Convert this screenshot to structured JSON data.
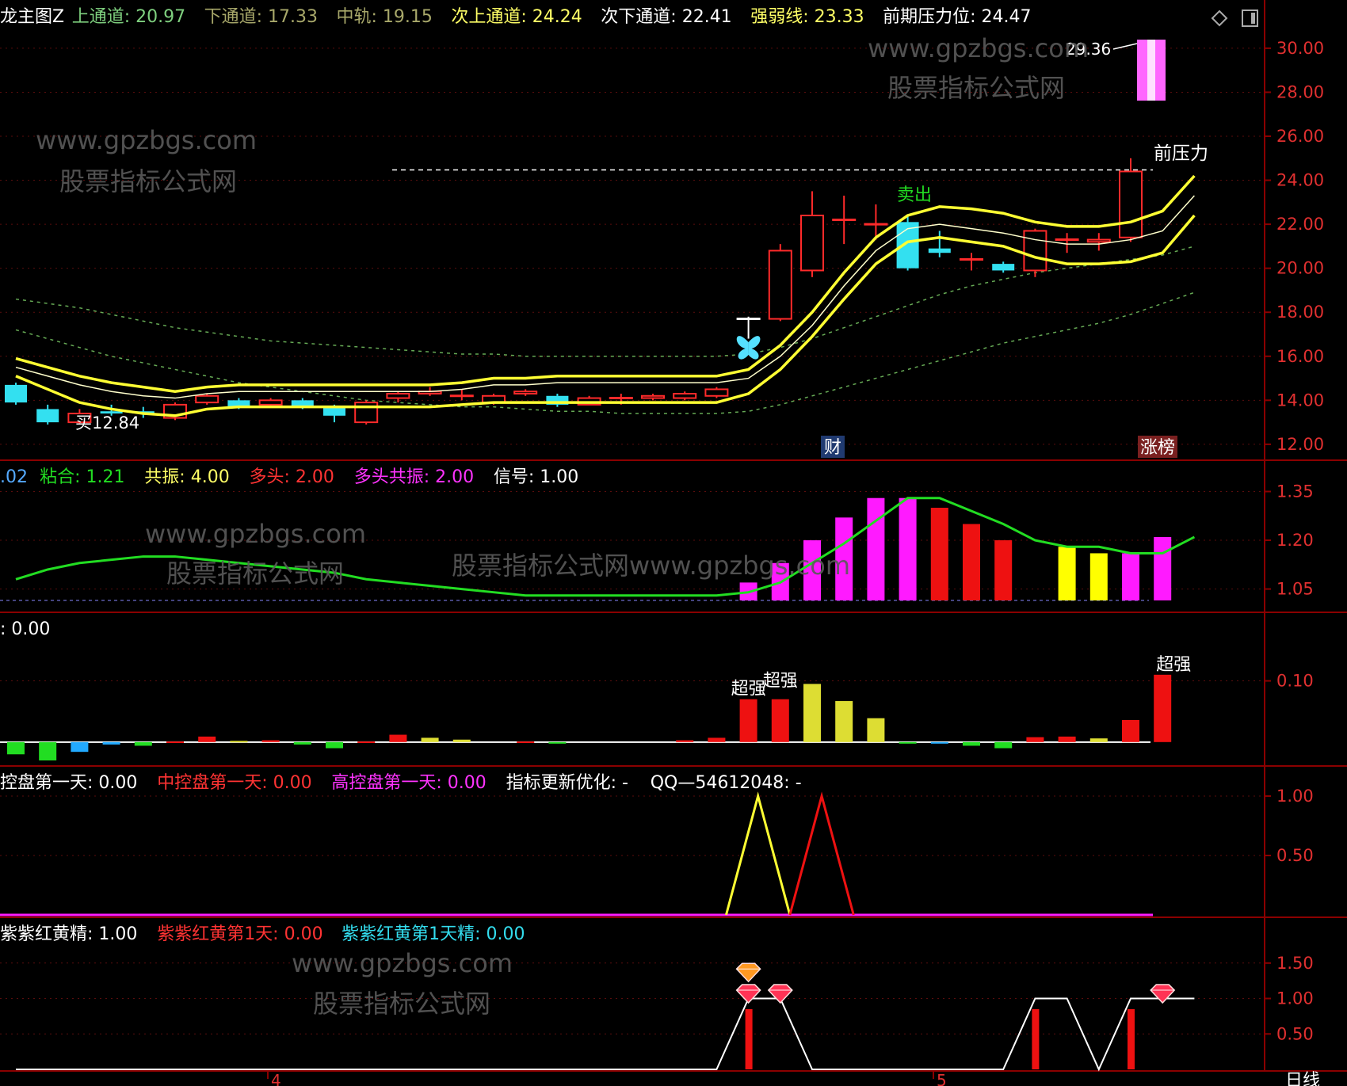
{
  "colors": {
    "background": "#000000",
    "panel_border": "#8b0000",
    "axis_text": "#e03030",
    "channel": "#ffff33",
    "up": "#ff2a2a",
    "down": "#33e0f0",
    "magenta": "#ff1aff",
    "yellow": "#ffff00",
    "green": "#22dd22",
    "white": "#ffffff"
  },
  "toolbar": {
    "diamond_icon": "diamond-icon",
    "window_icon": "window-icon"
  },
  "watermarks": {
    "url": "www.gpzbgs.com",
    "cn": "股票指标公式网",
    "combined": "股票指标公式网www.gpzbgs.com"
  },
  "timeline": {
    "labels": [
      "4",
      "5"
    ],
    "period": "日线"
  },
  "chart_data": [
    {
      "type": "candlestick",
      "panel": "main",
      "header": [
        {
          "text": "龙主图Z",
          "color": "#ffffff"
        },
        {
          "text": "上通道: 20.97",
          "color": "#7fd07f"
        },
        {
          "text": "下通道: 17.33",
          "color": "#a8a86a"
        },
        {
          "text": "中轨: 19.15",
          "color": "#a8a86a"
        },
        {
          "text": "次上通道: 24.24",
          "color": "#ffff66"
        },
        {
          "text": "次下通道: 22.41",
          "color": "#ffffff"
        },
        {
          "text": "强弱线: 23.33",
          "color": "#ffff66"
        },
        {
          "text": "前期压力位: 24.47",
          "color": "#ffffff"
        }
      ],
      "ylim": [
        11.6,
        31.4
      ],
      "yticks": [
        "12.00",
        "14.00",
        "16.00",
        "18.00",
        "20.00",
        "22.00",
        "24.00",
        "26.00",
        "28.00",
        "30.00"
      ],
      "grid": true,
      "candles": [
        {
          "o": 14.7,
          "c": 13.9,
          "h": 14.8,
          "l": 13.8
        },
        {
          "o": 13.6,
          "c": 13.0,
          "h": 13.8,
          "l": 12.9
        },
        {
          "o": 13.0,
          "c": 13.4,
          "h": 13.6,
          "l": 12.9
        },
        {
          "o": 13.5,
          "c": 13.4,
          "h": 13.8,
          "l": 13.3
        },
        {
          "o": 13.5,
          "c": 13.4,
          "h": 13.7,
          "l": 13.2
        },
        {
          "o": 13.2,
          "c": 13.8,
          "h": 13.9,
          "l": 13.1
        },
        {
          "o": 13.9,
          "c": 14.2,
          "h": 14.3,
          "l": 13.8
        },
        {
          "o": 14.0,
          "c": 13.7,
          "h": 14.1,
          "l": 13.6
        },
        {
          "o": 13.8,
          "c": 14.0,
          "h": 14.1,
          "l": 13.7
        },
        {
          "o": 14.0,
          "c": 13.7,
          "h": 14.1,
          "l": 13.6
        },
        {
          "o": 13.7,
          "c": 13.3,
          "h": 13.8,
          "l": 13.0
        },
        {
          "o": 13.0,
          "c": 13.9,
          "h": 14.0,
          "l": 12.9
        },
        {
          "o": 14.1,
          "c": 14.3,
          "h": 14.4,
          "l": 13.9
        },
        {
          "o": 14.3,
          "c": 14.4,
          "h": 14.6,
          "l": 14.2
        },
        {
          "o": 14.2,
          "c": 14.2,
          "h": 14.5,
          "l": 14.0
        },
        {
          "o": 13.9,
          "c": 14.2,
          "h": 14.3,
          "l": 13.8
        },
        {
          "o": 14.3,
          "c": 14.4,
          "h": 14.5,
          "l": 14.2
        },
        {
          "o": 14.2,
          "c": 13.8,
          "h": 14.3,
          "l": 13.7
        },
        {
          "o": 13.8,
          "c": 14.1,
          "h": 14.2,
          "l": 13.8
        },
        {
          "o": 14.1,
          "c": 14.1,
          "h": 14.3,
          "l": 13.8
        },
        {
          "o": 14.1,
          "c": 14.2,
          "h": 14.3,
          "l": 14.0
        },
        {
          "o": 14.1,
          "c": 14.3,
          "h": 14.4,
          "l": 14.0
        },
        {
          "o": 14.2,
          "c": 14.5,
          "h": 14.6,
          "l": 14.1
        },
        {
          "o": 17.7,
          "c": 17.7,
          "h": 17.8,
          "l": 16.8
        },
        {
          "o": 17.7,
          "c": 20.8,
          "h": 21.1,
          "l": 17.6
        },
        {
          "o": 19.9,
          "c": 22.4,
          "h": 23.5,
          "l": 19.6
        },
        {
          "o": 22.2,
          "c": 22.2,
          "h": 23.3,
          "l": 21.1
        },
        {
          "o": 22.0,
          "c": 22.0,
          "h": 22.9,
          "l": 21.3
        },
        {
          "o": 22.1,
          "c": 20.0,
          "h": 22.4,
          "l": 19.9
        },
        {
          "o": 20.9,
          "c": 20.7,
          "h": 21.7,
          "l": 20.5
        },
        {
          "o": 20.4,
          "c": 20.4,
          "h": 20.7,
          "l": 19.9
        },
        {
          "o": 20.2,
          "c": 19.9,
          "h": 20.3,
          "l": 19.8
        },
        {
          "o": 19.9,
          "c": 21.7,
          "h": 21.8,
          "l": 19.6
        },
        {
          "o": 21.3,
          "c": 21.3,
          "h": 21.6,
          "l": 20.7
        },
        {
          "o": 21.2,
          "c": 21.3,
          "h": 21.6,
          "l": 20.8
        },
        {
          "o": 21.4,
          "c": 24.4,
          "h": 25.0,
          "l": 21.2
        }
      ],
      "lines": [
        {
          "name": "上通道",
          "values": [
            15.9,
            15.5,
            15.1,
            14.8,
            14.6,
            14.4,
            14.6,
            14.7,
            14.7,
            14.7,
            14.7,
            14.7,
            14.7,
            14.7,
            14.8,
            15.0,
            15.0,
            15.1,
            15.1,
            15.1,
            15.1,
            15.1,
            15.1,
            15.4,
            16.5,
            18.0,
            19.8,
            21.4,
            22.4,
            22.8,
            22.7,
            22.5,
            22.1,
            21.9,
            21.9,
            22.1,
            22.6,
            24.2
          ]
        },
        {
          "name": "中轨",
          "values": [
            15.5,
            15.1,
            14.7,
            14.4,
            14.2,
            14.1,
            14.3,
            14.4,
            14.4,
            14.4,
            14.4,
            14.4,
            14.4,
            14.4,
            14.5,
            14.7,
            14.7,
            14.8,
            14.8,
            14.8,
            14.8,
            14.8,
            14.8,
            15.0,
            16.0,
            17.4,
            19.2,
            20.8,
            21.8,
            22.0,
            21.8,
            21.6,
            21.3,
            21.1,
            21.1,
            21.3,
            21.7,
            23.3
          ]
        },
        {
          "name": "下通道",
          "values": [
            15.1,
            14.5,
            13.9,
            13.6,
            13.4,
            13.3,
            13.6,
            13.7,
            13.7,
            13.7,
            13.7,
            13.7,
            13.7,
            13.7,
            13.8,
            13.9,
            13.9,
            13.9,
            13.9,
            13.9,
            13.9,
            13.9,
            13.9,
            14.3,
            15.4,
            16.9,
            18.6,
            20.2,
            21.2,
            21.4,
            21.2,
            21.0,
            20.5,
            20.2,
            20.2,
            20.3,
            20.7,
            22.4
          ]
        },
        {
          "name": "上虚线",
          "values": [
            18.6,
            18.4,
            18.2,
            17.9,
            17.6,
            17.3,
            17.1,
            16.9,
            16.7,
            16.6,
            16.5,
            16.4,
            16.3,
            16.2,
            16.1,
            16.1,
            16.0,
            16.0,
            16.0,
            16.0,
            16.0,
            16.0,
            16.0,
            16.1,
            16.4,
            16.8,
            17.3,
            17.8,
            18.3,
            18.8,
            19.2,
            19.5,
            19.8,
            20.0,
            20.2,
            20.4,
            20.6,
            21.0
          ]
        },
        {
          "name": "下虚线",
          "values": [
            17.2,
            16.8,
            16.4,
            16.0,
            15.7,
            15.4,
            15.1,
            14.8,
            14.6,
            14.4,
            14.2,
            14.0,
            13.9,
            13.8,
            13.7,
            13.7,
            13.6,
            13.5,
            13.5,
            13.4,
            13.4,
            13.4,
            13.4,
            13.5,
            13.8,
            14.2,
            14.6,
            15.0,
            15.4,
            15.8,
            16.2,
            16.6,
            16.9,
            17.2,
            17.5,
            17.9,
            18.4,
            18.9
          ]
        }
      ],
      "pressure_level": 24.47,
      "labels": {
        "buy": "买12.84",
        "sell": "卖出",
        "pressure": "前压力",
        "cai": "财",
        "zhangbang": "涨榜",
        "peak": "29.36"
      }
    },
    {
      "type": "bar",
      "panel": "sub1",
      "header": [
        {
          "text": ".02",
          "color": "#55aaff"
        },
        {
          "text": "粘合: 1.21",
          "color": "#22dd22"
        },
        {
          "text": "共振: 4.00",
          "color": "#ffff66"
        },
        {
          "text": "多头: 2.00",
          "color": "#ff3333"
        },
        {
          "text": "多头共振: 2.00",
          "color": "#ff33ff"
        },
        {
          "text": "信号: 1.00",
          "color": "#ffffff"
        }
      ],
      "ylim": [
        1.01,
        1.4
      ],
      "yticks": [
        "1.35",
        "1.20",
        "1.05"
      ],
      "line_values": [
        1.08,
        1.11,
        1.13,
        1.14,
        1.15,
        1.15,
        1.14,
        1.13,
        1.12,
        1.11,
        1.1,
        1.08,
        1.07,
        1.06,
        1.05,
        1.04,
        1.03,
        1.03,
        1.03,
        1.03,
        1.03,
        1.03,
        1.03,
        1.04,
        1.07,
        1.13,
        1.19,
        1.26,
        1.33,
        1.33,
        1.29,
        1.25,
        1.2,
        1.18,
        1.18,
        1.16,
        1.16,
        1.21
      ],
      "bars": [
        {
          "i": 23,
          "v": 1.07,
          "color": "#ff1aff"
        },
        {
          "i": 24,
          "v": 1.13,
          "color": "#ff1aff"
        },
        {
          "i": 25,
          "v": 1.2,
          "color": "#ff1aff"
        },
        {
          "i": 26,
          "v": 1.27,
          "color": "#ff1aff"
        },
        {
          "i": 27,
          "v": 1.33,
          "color": "#ff1aff"
        },
        {
          "i": 28,
          "v": 1.33,
          "color": "#ff1aff"
        },
        {
          "i": 29,
          "v": 1.3,
          "color": "#ee1111"
        },
        {
          "i": 30,
          "v": 1.25,
          "color": "#ee1111"
        },
        {
          "i": 31,
          "v": 1.2,
          "color": "#ee1111"
        },
        {
          "i": 33,
          "v": 1.18,
          "color": "#ffff00"
        },
        {
          "i": 34,
          "v": 1.16,
          "color": "#ffff00"
        },
        {
          "i": 35,
          "v": 1.16,
          "color": "#ff1aff"
        },
        {
          "i": 36,
          "v": 1.21,
          "color": "#ff1aff"
        }
      ]
    },
    {
      "type": "bar",
      "panel": "sub2",
      "header": [
        {
          "text": ": 0.00",
          "color": "#ffffff"
        }
      ],
      "ylim": [
        -0.03,
        0.19
      ],
      "yticks": [
        "0.10"
      ],
      "bars": [
        {
          "i": 0,
          "v": -0.02,
          "color": "#22dd22"
        },
        {
          "i": 1,
          "v": -0.03,
          "color": "#22dd22"
        },
        {
          "i": 2,
          "v": -0.016,
          "color": "#22aaff"
        },
        {
          "i": 3,
          "v": -0.004,
          "color": "#22aaff"
        },
        {
          "i": 4,
          "v": -0.006,
          "color": "#22dd22"
        },
        {
          "i": 5,
          "v": 0.001,
          "color": "#ee1111"
        },
        {
          "i": 6,
          "v": 0.009,
          "color": "#ee1111"
        },
        {
          "i": 7,
          "v": 0.002,
          "color": "#dddd33"
        },
        {
          "i": 8,
          "v": 0.003,
          "color": "#ee1111"
        },
        {
          "i": 9,
          "v": -0.004,
          "color": "#22dd22"
        },
        {
          "i": 10,
          "v": -0.01,
          "color": "#22dd22"
        },
        {
          "i": 11,
          "v": 0.001,
          "color": "#ee1111"
        },
        {
          "i": 12,
          "v": 0.012,
          "color": "#ee1111"
        },
        {
          "i": 13,
          "v": 0.007,
          "color": "#dddd33"
        },
        {
          "i": 14,
          "v": 0.004,
          "color": "#dddd33"
        },
        {
          "i": 16,
          "v": 0.001,
          "color": "#ee1111"
        },
        {
          "i": 17,
          "v": -0.002,
          "color": "#22dd22"
        },
        {
          "i": 21,
          "v": 0.003,
          "color": "#ee1111"
        },
        {
          "i": 22,
          "v": 0.007,
          "color": "#ee1111"
        },
        {
          "i": 23,
          "v": 0.07,
          "color": "#ee1111"
        },
        {
          "i": 24,
          "v": 0.07,
          "color": "#ee1111"
        },
        {
          "i": 25,
          "v": 0.095,
          "color": "#dddd33"
        },
        {
          "i": 26,
          "v": 0.067,
          "color": "#dddd33"
        },
        {
          "i": 27,
          "v": 0.039,
          "color": "#dddd33"
        },
        {
          "i": 28,
          "v": -0.002,
          "color": "#22dd22"
        },
        {
          "i": 29,
          "v": -0.002,
          "color": "#22aaff"
        },
        {
          "i": 30,
          "v": -0.006,
          "color": "#22dd22"
        },
        {
          "i": 31,
          "v": -0.01,
          "color": "#22dd22"
        },
        {
          "i": 32,
          "v": 0.008,
          "color": "#ee1111"
        },
        {
          "i": 33,
          "v": 0.009,
          "color": "#ee1111"
        },
        {
          "i": 34,
          "v": 0.006,
          "color": "#dddd33"
        },
        {
          "i": 35,
          "v": 0.036,
          "color": "#ee1111"
        },
        {
          "i": 36,
          "v": 0.11,
          "color": "#ee1111"
        }
      ],
      "labels": [
        {
          "i": 23,
          "text": "超强"
        },
        {
          "i": 24,
          "text": "超强"
        },
        {
          "i": 36,
          "text": "超强"
        }
      ]
    },
    {
      "type": "line",
      "panel": "sub3",
      "header": [
        {
          "text": "控盘第一天: 0.00",
          "color": "#ffffff"
        },
        {
          "text": "中控盘第一天: 0.00",
          "color": "#ff3333"
        },
        {
          "text": "高控盘第一天: 0.00",
          "color": "#ff33ff"
        },
        {
          "text": "指标更新优化: -",
          "color": "#ffffff"
        },
        {
          "text": "QQ—54612048: -",
          "color": "#ffffff"
        }
      ],
      "ylim": [
        0,
        1.1
      ],
      "yticks": [
        "1.00",
        "0.50"
      ],
      "series": [
        {
          "color": "#ffff33",
          "x": [
            22.3,
            23.3,
            24.3
          ],
          "y": [
            0,
            1,
            0
          ]
        },
        {
          "color": "#ee1111",
          "x": [
            24.3,
            25.3,
            26.3
          ],
          "y": [
            0,
            1,
            0
          ]
        }
      ],
      "baseline_color": "#ff1aff"
    },
    {
      "type": "line",
      "panel": "sub4",
      "header": [
        {
          "text": "紫紫红黄精: 1.00",
          "color": "#ffffff"
        },
        {
          "text": "紫紫红黄第1天: 0.00",
          "color": "#ff3333"
        },
        {
          "text": "紫紫红黄第1天精: 0.00",
          "color": "#33ddee"
        }
      ],
      "ylim": [
        0,
        1.9
      ],
      "yticks": [
        "1.50",
        "1.00",
        "0.50"
      ],
      "line_values": [
        0,
        0,
        0,
        0,
        0,
        0,
        0,
        0,
        0,
        0,
        0,
        0,
        0,
        0,
        0,
        0,
        0,
        0,
        0,
        0,
        0,
        0,
        0,
        1,
        1,
        0,
        0,
        0,
        0,
        0,
        0,
        0,
        1,
        1,
        0,
        1,
        1,
        1
      ],
      "spikes": [
        23,
        32,
        35
      ],
      "gems": [
        {
          "i": 23,
          "v": 1.35,
          "kind": "gold"
        },
        {
          "i": 23,
          "v": 1.05,
          "kind": "red"
        },
        {
          "i": 24,
          "v": 1.05,
          "kind": "red"
        },
        {
          "i": 36,
          "v": 1.05,
          "kind": "red"
        }
      ]
    }
  ]
}
